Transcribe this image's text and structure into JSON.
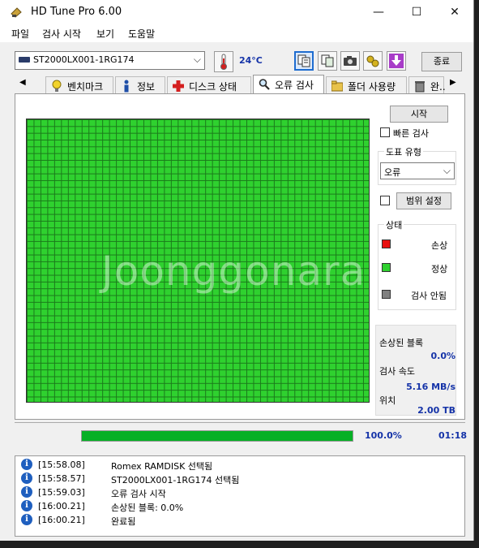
{
  "window": {
    "title": "HD Tune Pro 6.00",
    "controls": [
      "—",
      "☐",
      "✕"
    ]
  },
  "menu": [
    "파일",
    "검사 시작",
    "보기",
    "도움말"
  ],
  "toolbar": {
    "drive": "ST2000LX001-1RG174",
    "temperature": "24°C",
    "exit_label": "종료"
  },
  "tabs": [
    {
      "label": "벤치마크"
    },
    {
      "label": "정보"
    },
    {
      "label": "디스크 상태"
    },
    {
      "label": "오류 검사",
      "selected": true
    },
    {
      "label": "폴더 사용량"
    },
    {
      "label": "완.."
    }
  ],
  "error_scan": {
    "start_label": "시작",
    "quick_scan_label": "빠른 검사",
    "quick_scan_checked": false,
    "block_type_label": "도표 유형",
    "block_type_value": "오류",
    "range_checked": false,
    "range_label": "범위 설정",
    "legend_title": "상태",
    "legend": [
      {
        "label": "손상",
        "color": "#e81010"
      },
      {
        "label": "정상",
        "color": "#2fd12f"
      },
      {
        "label": "검사 안됨",
        "color": "#808080"
      }
    ],
    "stats": {
      "damaged_label": "손상된 블록",
      "damaged_value": "0.0%",
      "speed_label": "검사 속도",
      "speed_value": "5.16 MB/s",
      "position_label": "위치",
      "position_value": "2.00 TB"
    },
    "watermark": "Joonggonara"
  },
  "progress": {
    "percent_value": 100,
    "percent_label": "100.0%",
    "elapsed": "01:18"
  },
  "log": [
    {
      "time": "[15:58.08]",
      "message": "Romex   RAMDISK 선택됨"
    },
    {
      "time": "[15:58.57]",
      "message": "ST2000LX001-1RG174 선택됨"
    },
    {
      "time": "[15:59.03]",
      "message": "오류 검사 시작"
    },
    {
      "time": "[16:00.21]",
      "message": "손상된 블록: 0.0%"
    },
    {
      "time": "[16:00.21]",
      "message": "완료됨"
    }
  ],
  "colors": {
    "accent": "#1533a8",
    "grid_ok": "#2fd12f",
    "progress": "#06b025"
  }
}
